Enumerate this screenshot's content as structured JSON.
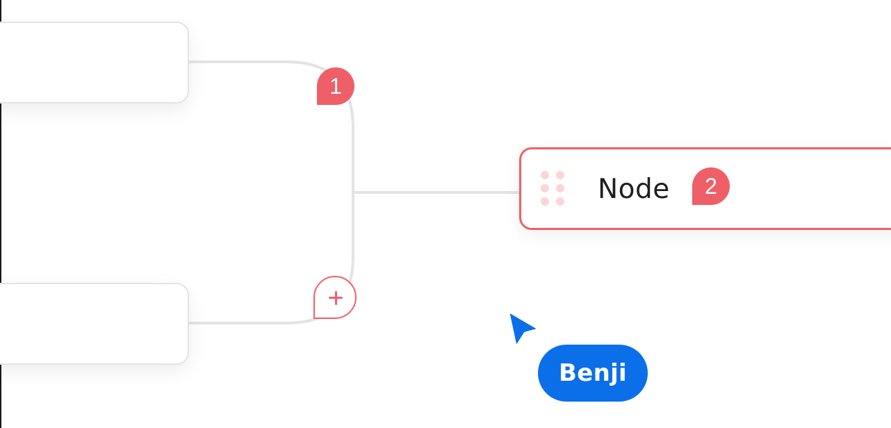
{
  "canvas": {
    "background": "#ffffff",
    "connector_color": "#e3e3e3",
    "accent_color": "#ef5f67",
    "user_color": "#0a6fe8"
  },
  "nodes": [
    {
      "id": "top-node",
      "label": ""
    },
    {
      "id": "bottom-node",
      "label": ""
    },
    {
      "id": "main-node",
      "label": "Node",
      "selected": true,
      "badge": "2"
    }
  ],
  "badges": {
    "comment_1": "1",
    "comment_2": "2"
  },
  "actions": {
    "add_icon": "plus-icon"
  },
  "collaborator": {
    "name": "Benji",
    "cursor_icon": "pointer-arrow-icon"
  }
}
